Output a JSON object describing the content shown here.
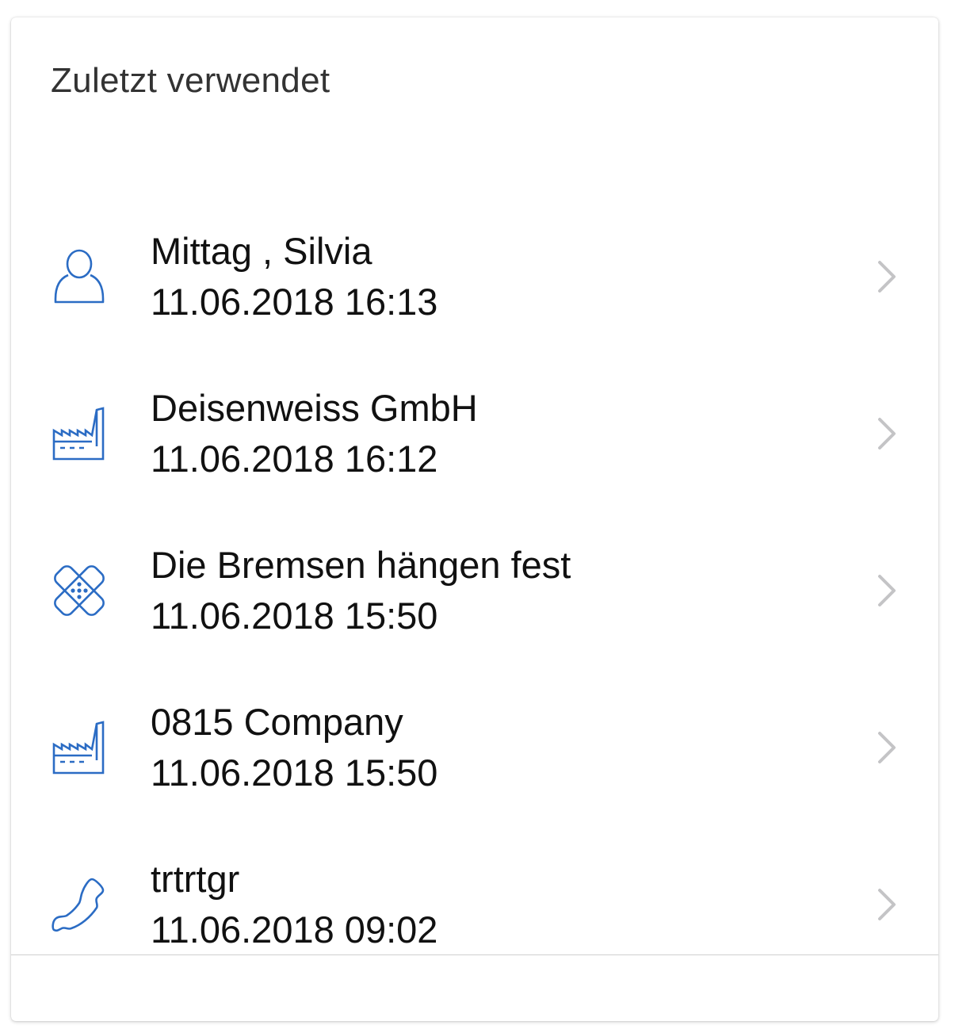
{
  "section": {
    "title": "Zuletzt verwendet"
  },
  "colors": {
    "icon_accent": "#2b6cc4",
    "chevron": "#c4c4c6",
    "text": "#111111",
    "title": "#333333"
  },
  "items": [
    {
      "icon": "person-icon",
      "title": "Mittag , Silvia",
      "date": "11.06.2018 16:13"
    },
    {
      "icon": "factory-icon",
      "title": "Deisenweiss GmbH",
      "date": "11.06.2018 16:12"
    },
    {
      "icon": "bandage-icon",
      "title": "Die Bremsen hängen fest",
      "date": "11.06.2018 15:50"
    },
    {
      "icon": "factory-icon",
      "title": "0815 Company",
      "date": "11.06.2018 15:50"
    },
    {
      "icon": "phone-icon",
      "title": "trtrtgr",
      "date": "11.06.2018 09:02"
    }
  ]
}
